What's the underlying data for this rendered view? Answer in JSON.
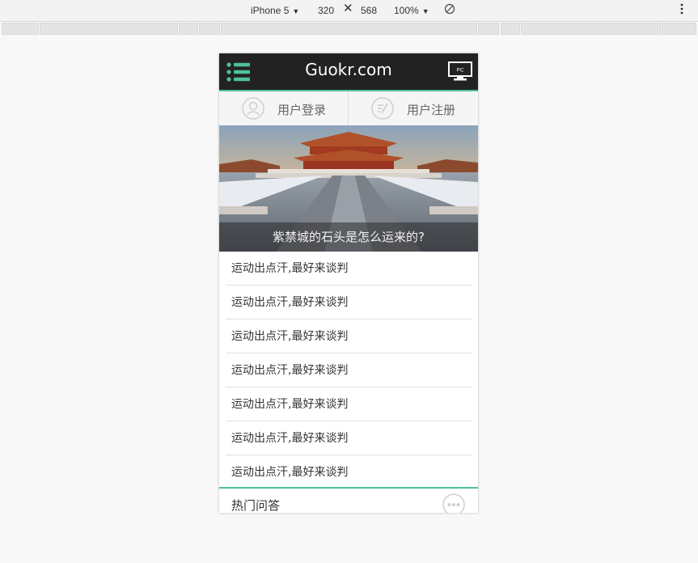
{
  "devtools": {
    "device": "iPhone 5",
    "width": "320",
    "times": "✕",
    "height": "568",
    "zoom": "100%"
  },
  "app": {
    "logo": "Guokr.com",
    "pc_label": "PC",
    "accent_color": "#4fbf9b",
    "header_bg": "#222222",
    "login": {
      "label": "用户登录",
      "icon": "user-icon"
    },
    "register": {
      "label": "用户注册",
      "icon": "edit-icon"
    },
    "banner": {
      "caption": "紫禁城的石头是怎么运来的?"
    },
    "list": [
      "运动出点汗,最好来谈判",
      "运动出点汗,最好来谈判",
      "运动出点汗,最好来谈判",
      "运动出点汗,最好来谈判",
      "运动出点汗,最好来谈判",
      "运动出点汗,最好来谈判",
      "运动出点汗,最好来谈判"
    ],
    "hot_section": {
      "title": "热门问答",
      "icon": "more-icon"
    }
  }
}
